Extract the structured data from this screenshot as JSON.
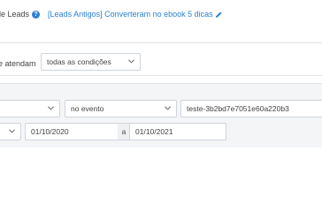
{
  "header": {
    "crumb": "de Leads",
    "help_icon": "?",
    "link_text": "[Leads Antigos] Converteram no ebook 5 dicas"
  },
  "filter": {
    "label_tail": "e atendam",
    "condition_select": "todas as condições"
  },
  "rule": {
    "event_select": "no evento",
    "event_value": "teste-3b2bd7e7051e60a220b3"
  },
  "dates": {
    "start": "01/10/2020",
    "sep": "a",
    "end": "01/10/2021"
  }
}
